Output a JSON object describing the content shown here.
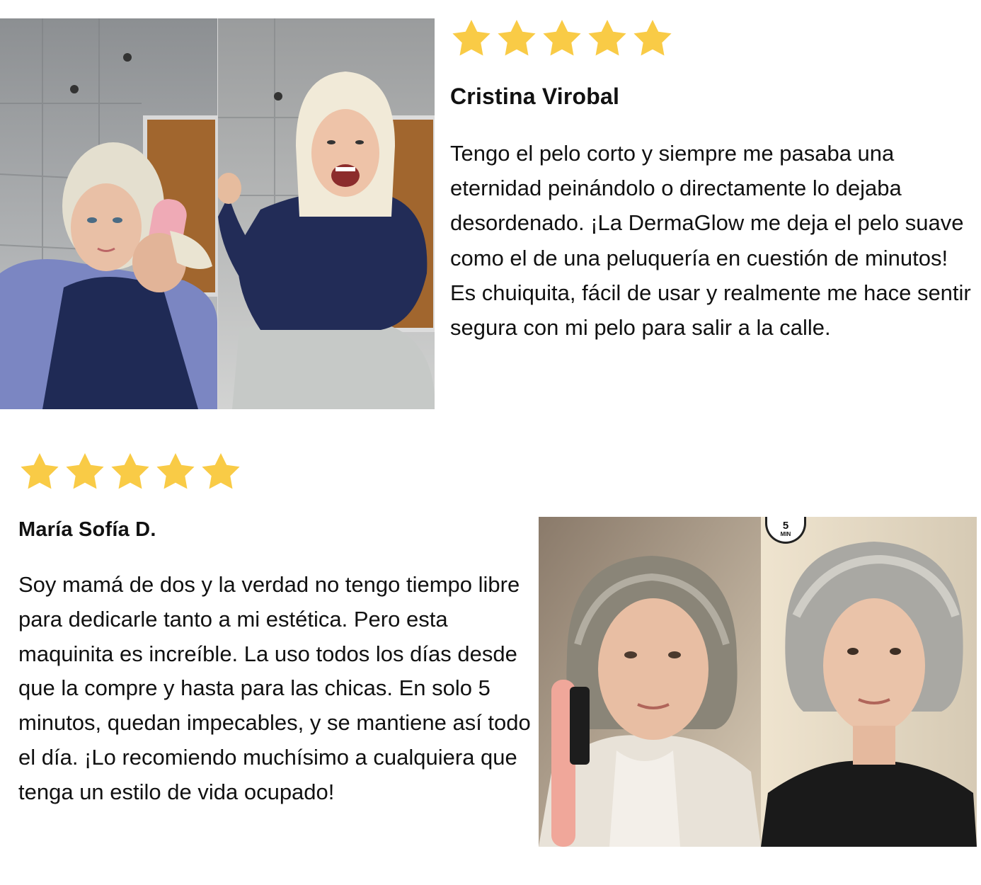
{
  "colors": {
    "star": "#F9CB46",
    "text": "#111111",
    "background": "#FFFFFF"
  },
  "reviews": [
    {
      "rating": 5,
      "name": "Cristina Virobal",
      "text": "Tengo el pelo corto y siempre me pasaba una eternidad peinándolo o directamente lo dejaba desordenado. ¡La DermaGlow me deja el pelo suave como el de una peluquería en cuestión de minutos! Es chuiquita, fácil de usar y realmente me hace sentir segura con mi pelo para salir a la calle."
    },
    {
      "rating": 5,
      "name": "María Sofía D.",
      "text": "Soy mamá de dos y la verdad no tengo tiempo libre para dedicarle tanto a mi estética. Pero esta maquinita es increíble. La uso todos los días desde que la compre y hasta para las chicas. En solo 5 minutos,  quedan impecables, y se mantiene así todo el día. ¡Lo recomiendo muchísimo a cualquiera que tenga un estilo de vida ocupado!",
      "timer_badge": {
        "number": "5",
        "unit": "MIN"
      }
    }
  ]
}
